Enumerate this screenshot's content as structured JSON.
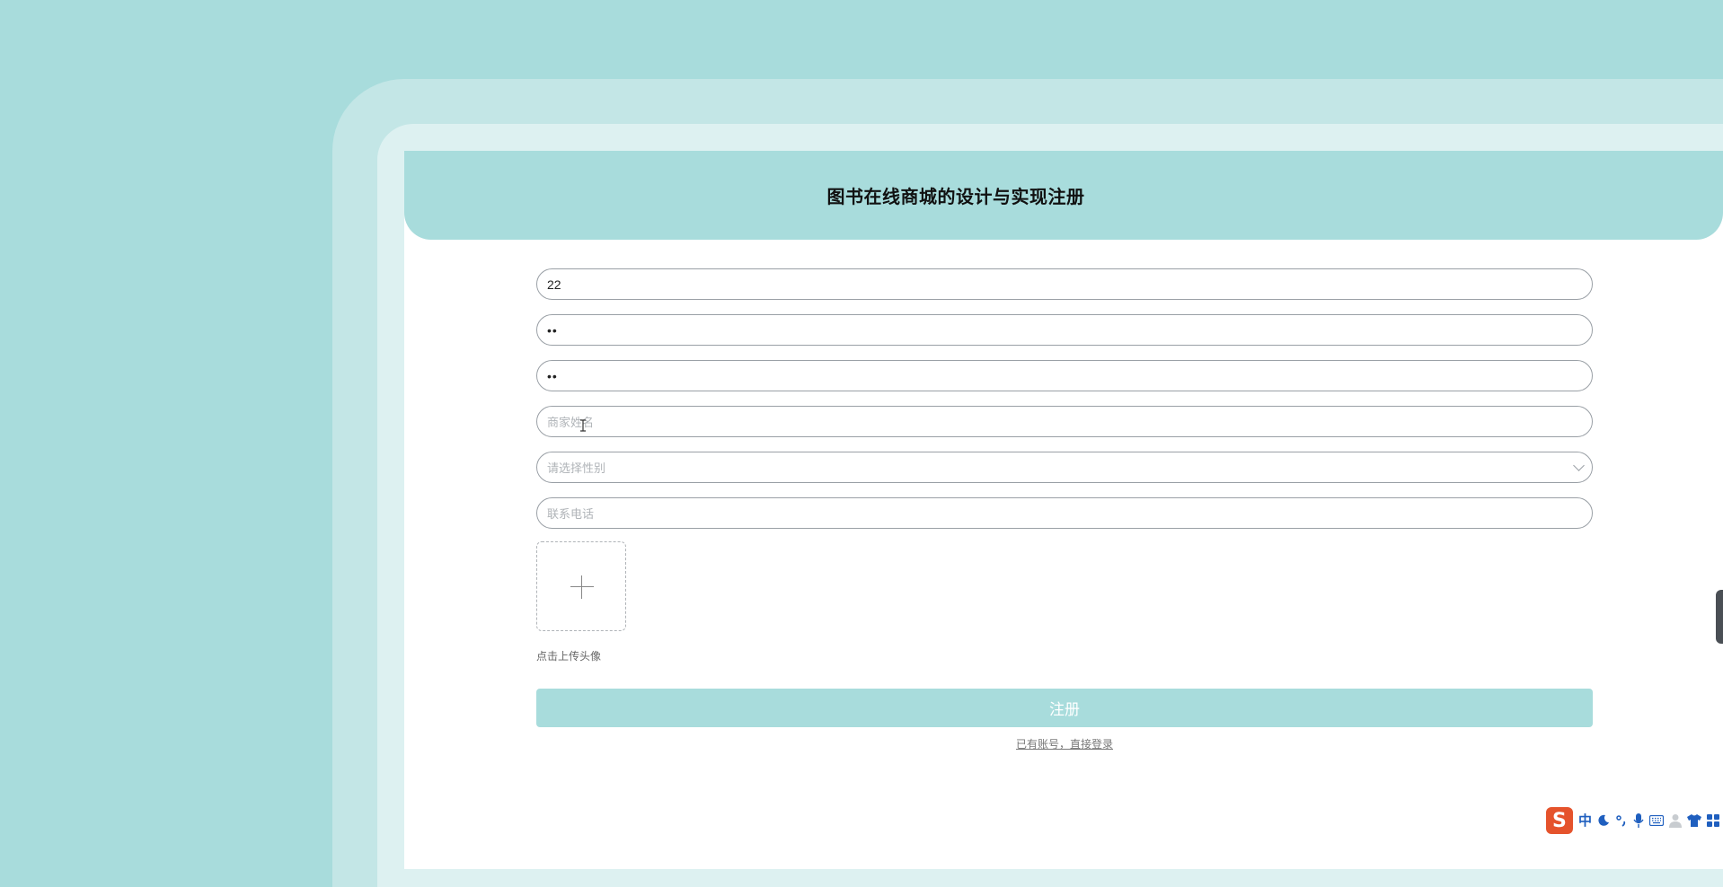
{
  "page": {
    "title": "图书在线商城的设计与实现注册"
  },
  "form": {
    "username": {
      "value": "22",
      "placeholder": ""
    },
    "password": {
      "display": "••"
    },
    "confirm_password": {
      "display": "••"
    },
    "merchant_name": {
      "value": "",
      "placeholder": "商家姓名"
    },
    "gender": {
      "value": "",
      "placeholder": "请选择性别"
    },
    "phone": {
      "value": "",
      "placeholder": "联系电话"
    },
    "avatar_upload_label": "点击上传头像",
    "submit_label": "注册",
    "login_link": "已有账号，直接登录"
  },
  "ime": {
    "logo": "S",
    "mode": "中",
    "icons": [
      "moon-icon",
      "punctuation-icon",
      "microphone-icon",
      "keyboard-icon",
      "user-icon",
      "shirt-icon",
      "apps-icon"
    ]
  },
  "colors": {
    "background": "#a8dcdc",
    "frame_outer": "#c3e6e6",
    "frame_mid": "#ddf1f1",
    "header": "#a8dcdc",
    "button": "#a8dcdc",
    "ime_logo": "#e5532c",
    "ime_icon": "#1f5fbf"
  }
}
